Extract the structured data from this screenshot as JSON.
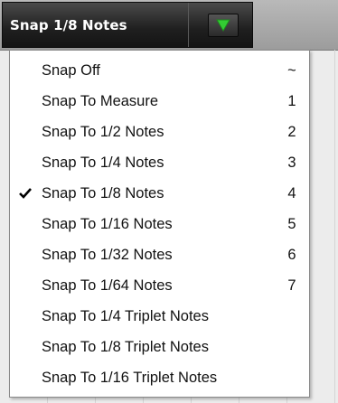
{
  "snap_dropdown": {
    "selected_label": "Snap 1/8 Notes",
    "arrow_icon": "triangle-down-icon",
    "arrow_color": "#33cc33"
  },
  "snap_menu": {
    "items": [
      {
        "label": "Snap Off",
        "shortcut": "~",
        "checked": false
      },
      {
        "label": "Snap To Measure",
        "shortcut": "1",
        "checked": false
      },
      {
        "label": "Snap To 1/2 Notes",
        "shortcut": "2",
        "checked": false
      },
      {
        "label": "Snap To 1/4 Notes",
        "shortcut": "3",
        "checked": false
      },
      {
        "label": "Snap To 1/8 Notes",
        "shortcut": "4",
        "checked": true
      },
      {
        "label": "Snap To 1/16 Notes",
        "shortcut": "5",
        "checked": false
      },
      {
        "label": "Snap To 1/32 Notes",
        "shortcut": "6",
        "checked": false
      },
      {
        "label": "Snap To 1/64 Notes",
        "shortcut": "7",
        "checked": false
      },
      {
        "label": "Snap To 1/4 Triplet Notes",
        "shortcut": "",
        "checked": false
      },
      {
        "label": "Snap To 1/8 Triplet Notes",
        "shortcut": "",
        "checked": false
      },
      {
        "label": "Snap To 1/16 Triplet Notes",
        "shortcut": "",
        "checked": false
      }
    ],
    "check_icon": "checkmark-icon"
  }
}
